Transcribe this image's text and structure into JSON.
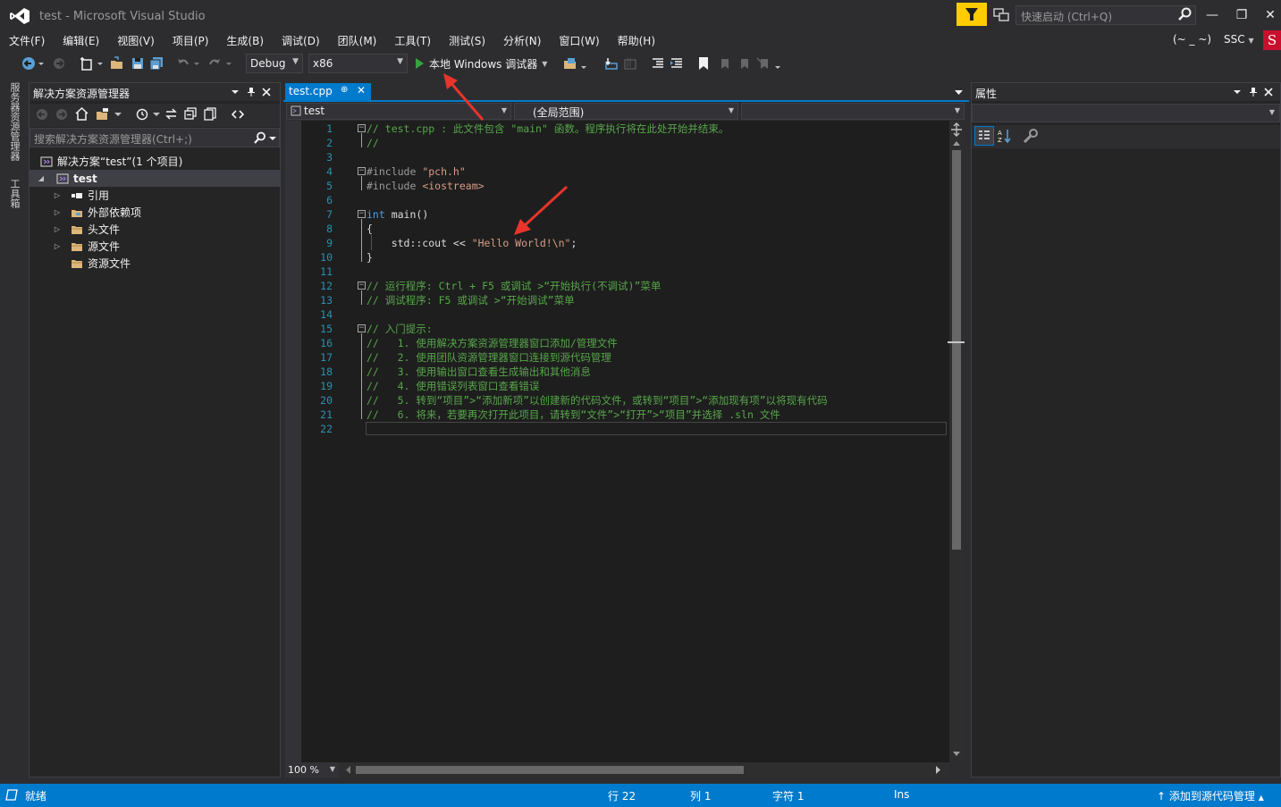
{
  "window": {
    "title": "test - Microsoft Visual Studio",
    "quick_launch_placeholder": "快速启动 (Ctrl+Q)",
    "account_name": "(~ _ ~)",
    "account_initials": "SSC",
    "badge_letter": "S",
    "minimize": "—",
    "restore": "❐",
    "close": "✕"
  },
  "menu": [
    "文件(F)",
    "编辑(E)",
    "视图(V)",
    "项目(P)",
    "生成(B)",
    "调试(D)",
    "团队(M)",
    "工具(T)",
    "测试(S)",
    "分析(N)",
    "窗口(W)",
    "帮助(H)"
  ],
  "toolbar": {
    "configuration": "Debug",
    "platform": "x86",
    "run_label": "本地 Windows 调试器"
  },
  "left_tabs": [
    "服务器资源管理器",
    "工具箱"
  ],
  "solution_explorer": {
    "title": "解决方案资源管理器",
    "search_placeholder": "搜索解决方案资源管理器(Ctrl+;)",
    "solution_label": "解决方案“test”(1 个项目)",
    "project_label": "test",
    "items": [
      {
        "label": "引用",
        "icon": "references-icon",
        "expandable": true
      },
      {
        "label": "外部依赖项",
        "icon": "external-deps-icon",
        "expandable": true
      },
      {
        "label": "头文件",
        "icon": "folder-icon",
        "expandable": true
      },
      {
        "label": "源文件",
        "icon": "folder-icon",
        "expandable": true
      },
      {
        "label": "资源文件",
        "icon": "folder-icon",
        "expandable": false
      }
    ]
  },
  "editor": {
    "tab_label": "test.cpp",
    "nav_project": "test",
    "nav_scope": "(全局范围)",
    "zoom": "100 %",
    "lines": [
      {
        "n": "1",
        "parts": [
          [
            "c-comment",
            "// test.cpp : 此文件包含 \"main\" 函数。程序执行将在此处开始并结束。"
          ]
        ]
      },
      {
        "n": "2",
        "parts": [
          [
            "c-comment",
            "//"
          ]
        ]
      },
      {
        "n": "3",
        "parts": []
      },
      {
        "n": "4",
        "parts": [
          [
            "c-pp",
            "#include "
          ],
          [
            "c-str",
            "\"pch.h\""
          ]
        ]
      },
      {
        "n": "5",
        "parts": [
          [
            "c-pp",
            "#include "
          ],
          [
            "c-str",
            "<iostream>"
          ]
        ]
      },
      {
        "n": "6",
        "parts": []
      },
      {
        "n": "7",
        "parts": [
          [
            "c-kw",
            "int"
          ],
          [
            "",
            " main()"
          ]
        ]
      },
      {
        "n": "8",
        "parts": [
          [
            "",
            "{"
          ]
        ]
      },
      {
        "n": "9",
        "parts": [
          [
            "",
            "    std::cout << "
          ],
          [
            "c-str",
            "\"Hello World!\\n\""
          ],
          [
            "",
            ";"
          ]
        ]
      },
      {
        "n": "10",
        "parts": [
          [
            "",
            "}"
          ]
        ]
      },
      {
        "n": "11",
        "parts": []
      },
      {
        "n": "12",
        "parts": [
          [
            "c-comment",
            "// 运行程序: Ctrl + F5 或调试 >“开始执行(不调试)”菜单"
          ]
        ]
      },
      {
        "n": "13",
        "parts": [
          [
            "c-comment",
            "// 调试程序: F5 或调试 >“开始调试”菜单"
          ]
        ]
      },
      {
        "n": "14",
        "parts": []
      },
      {
        "n": "15",
        "parts": [
          [
            "c-comment",
            "// 入门提示:"
          ]
        ]
      },
      {
        "n": "16",
        "parts": [
          [
            "c-comment",
            "//   1. 使用解决方案资源管理器窗口添加/管理文件"
          ]
        ]
      },
      {
        "n": "17",
        "parts": [
          [
            "c-comment",
            "//   2. 使用团队资源管理器窗口连接到源代码管理"
          ]
        ]
      },
      {
        "n": "18",
        "parts": [
          [
            "c-comment",
            "//   3. 使用输出窗口查看生成输出和其他消息"
          ]
        ]
      },
      {
        "n": "19",
        "parts": [
          [
            "c-comment",
            "//   4. 使用错误列表窗口查看错误"
          ]
        ]
      },
      {
        "n": "20",
        "parts": [
          [
            "c-comment",
            "//   5. 转到“项目”>“添加新项”以创建新的代码文件，或转到“项目”>“添加现有项”以将现有代码"
          ]
        ]
      },
      {
        "n": "21",
        "parts": [
          [
            "c-comment",
            "//   6. 将来，若要再次打开此项目，请转到“文件”>“打开”>“项目”并选择 .sln 文件"
          ]
        ]
      },
      {
        "n": "22",
        "parts": []
      }
    ]
  },
  "properties": {
    "title": "属性"
  },
  "status": {
    "ready": "就绪",
    "line": "行 22",
    "col": "列 1",
    "char": "字符 1",
    "mode": "Ins",
    "source_control": "添加到源代码管理"
  },
  "colors": {
    "accent": "#007acc",
    "arrow": "#e8342a",
    "filter": "#ffcc00"
  }
}
